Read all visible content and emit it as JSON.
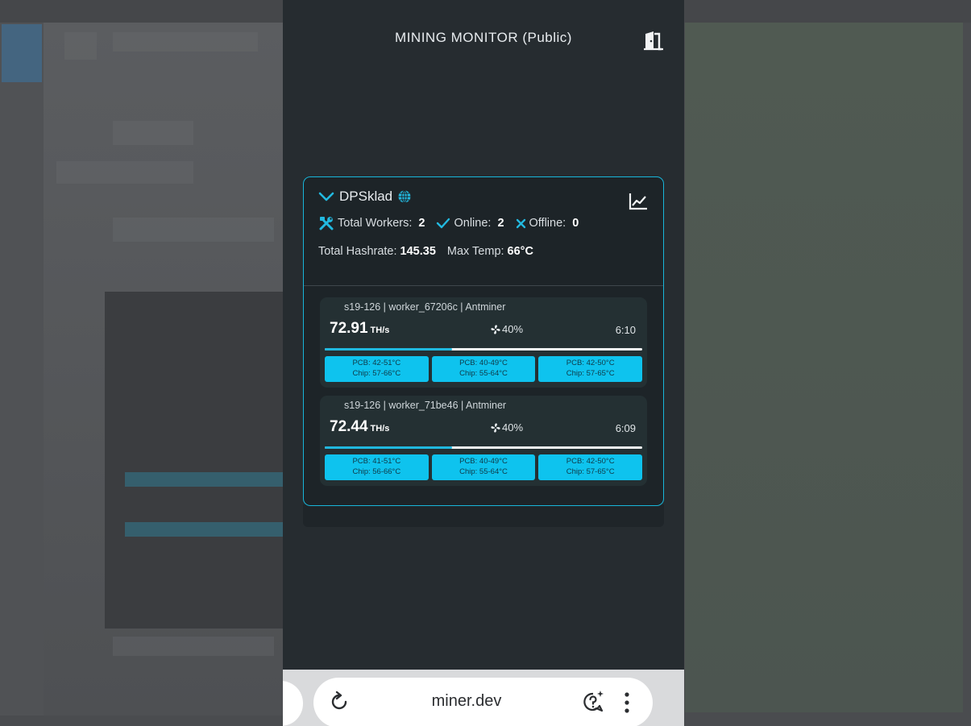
{
  "app": {
    "title": "MINING MONITOR (Public)"
  },
  "group": {
    "name": "DPSklad",
    "total_workers_label": "Total Workers:",
    "total_workers": "2",
    "online_label": "Online:",
    "online": "2",
    "offline_label": "Offline:",
    "offline": "0",
    "total_hashrate_label": "Total Hashrate:",
    "total_hashrate": "145.35",
    "max_temp_label": "Max Temp:",
    "max_temp": "66°C"
  },
  "workers": [
    {
      "title": "s19-126 | worker_67206c | Antminer",
      "hashrate": "72.91",
      "unit": "TH/s",
      "fan": "40%",
      "uptime": "6:10",
      "progress_percent": 40,
      "boards": [
        {
          "pcb": "PCB: 42-51°C",
          "chip": "Chip: 57-66°C"
        },
        {
          "pcb": "PCB: 40-49°C",
          "chip": "Chip: 55-64°C"
        },
        {
          "pcb": "PCB: 42-50°C",
          "chip": "Chip: 57-65°C"
        }
      ]
    },
    {
      "title": "s19-126 | worker_71be46 | Antminer",
      "hashrate": "72.44",
      "unit": "TH/s",
      "fan": "40%",
      "uptime": "6:09",
      "progress_percent": 40,
      "boards": [
        {
          "pcb": "PCB: 41-51°C",
          "chip": "Chip: 56-66°C"
        },
        {
          "pcb": "PCB: 40-49°C",
          "chip": "Chip: 55-64°C"
        },
        {
          "pcb": "PCB: 42-50°C",
          "chip": "Chip: 57-65°C"
        }
      ]
    }
  ],
  "browser": {
    "url": "miner.dev"
  },
  "icons": {
    "exit": "exit-door-icon",
    "chevron": "chevron-down-icon",
    "globe": "globe-icon",
    "chart": "line-chart-icon",
    "tools": "tools-icon",
    "check": "check-icon",
    "cross": "cross-icon",
    "fan": "fan-icon",
    "reload": "reload-icon",
    "help": "help-sparkle-icon",
    "menu": "kebab-menu-icon"
  },
  "colors": {
    "accent": "#18b6da",
    "board": "#0ec3ee",
    "background": "#262c30",
    "card": "#1d2428"
  }
}
